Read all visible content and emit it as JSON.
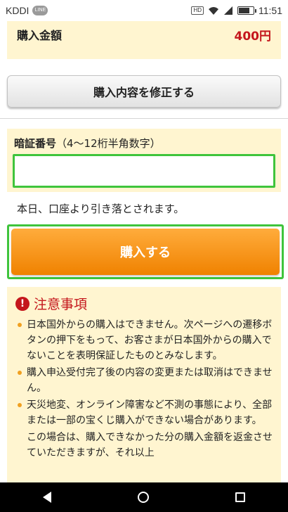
{
  "status_bar": {
    "carrier": "KDDI",
    "line_badge": "LINE",
    "network_badge": "HD",
    "time": "11:51"
  },
  "purchase": {
    "amount_label": "購入金額",
    "amount_value": "400円",
    "modify_button": "購入内容を修正する"
  },
  "pin": {
    "title_bold": "暗証番号",
    "title_hint": "（4～12桁半角数字）",
    "value": ""
  },
  "notice_text": "本日、口座より引き落とされます。",
  "buy_button": "購入する",
  "caution": {
    "title": "注意事項",
    "items": [
      "日本国外からの購入はできません。次ページへの遷移ボタンの押下をもって、お客さまが日本国外からの購入でないことを表明保証したものとみなします。",
      "購入申込受付完了後の内容の変更または取消はできません。",
      "天災地変、オンライン障害など不測の事態により、全部または一部の宝くじ購入ができない場合があります。"
    ],
    "extra": "この場合は、購入できなかった分の購入金額を返金させていただきますが、それ以上"
  },
  "colors": {
    "panel_bg": "#fff5d0",
    "highlight_green": "#3fc43c",
    "price_red": "#c4161c",
    "buy_orange": "#f08200"
  },
  "icons": [
    "line-badge-icon",
    "wifi-icon",
    "signal-icon",
    "battery-icon",
    "warning-icon",
    "back-icon",
    "home-icon",
    "recent-apps-icon"
  ]
}
